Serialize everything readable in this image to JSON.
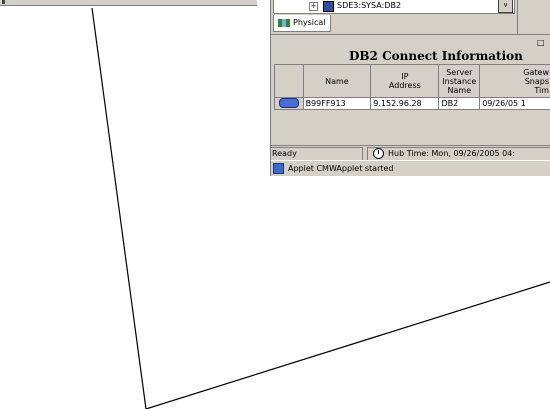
{
  "tree": {
    "expand_glyph": "+",
    "node_label": "SDE3:SYSA:DB2",
    "scroll_glyph": "∨"
  },
  "tabs": [
    {
      "label": "Physical",
      "icon": "network-icon"
    }
  ],
  "panel": {
    "title": "DB2 Connect Information",
    "toggle_glyph": "□"
  },
  "table": {
    "columns": [
      {
        "label": "Name"
      },
      {
        "label": "IP\nAddress"
      },
      {
        "label": "Server\nInstance\nName"
      },
      {
        "label": "Gatew\nSnaps\nTim"
      }
    ],
    "rows": [
      {
        "name": "B99FF913",
        "ip": "9.152.96.28",
        "instance": "DB2",
        "snapshot": "09/26/05 1"
      }
    ]
  },
  "status": {
    "ready": "Ready",
    "hub_time": "Hub Time: Mon, 09/26/2005 04:"
  },
  "browser_status": {
    "text": "Applet CMWApplet started"
  },
  "colors": {
    "window_bg": "#d4d0c8",
    "border": "#808080",
    "line": "#000000"
  }
}
